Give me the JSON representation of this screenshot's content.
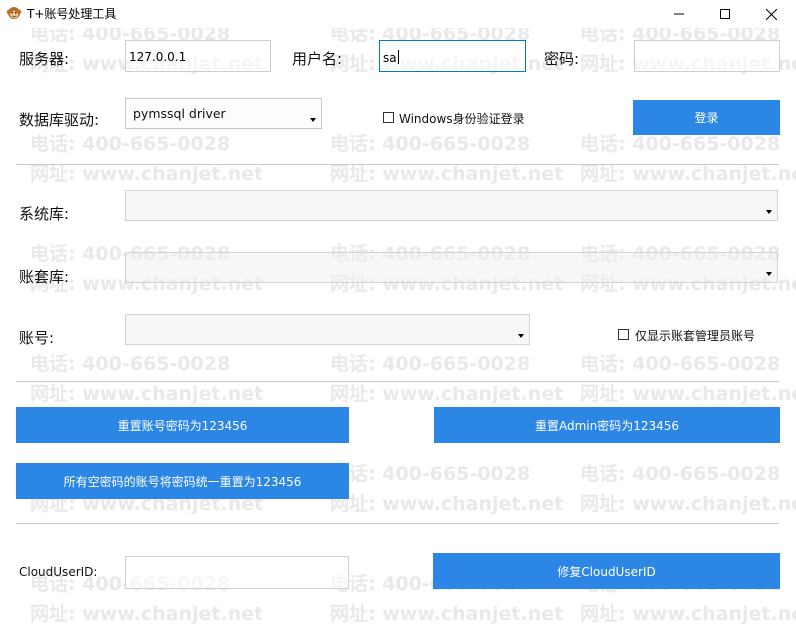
{
  "window": {
    "title": "T+账号处理工具",
    "app_icon": "monkey-icon",
    "controls": [
      "minimize-icon",
      "maximize-icon",
      "close-icon"
    ]
  },
  "watermark": {
    "phone": "电话: 400-665-0028",
    "site": "网址: www.chanjet.net",
    "color": "#e9e9e9"
  },
  "server": {
    "label": "服务器:",
    "value": "127.0.0.1"
  },
  "username": {
    "label": "用户名:",
    "value": "sa"
  },
  "password": {
    "label": "密码:",
    "value": ""
  },
  "driver": {
    "label": "数据库驱动:",
    "selected": "pymssql driver"
  },
  "windows_auth": {
    "label": "Windows身份验证登录",
    "checked": false
  },
  "login_button": "登录",
  "system_db": {
    "label": "系统库:",
    "selected": ""
  },
  "account_set_db": {
    "label": "账套库:",
    "selected": ""
  },
  "account": {
    "label": "账号:",
    "selected": ""
  },
  "admin_only": {
    "label": "仅显示账套管理员账号",
    "checked": false
  },
  "actions": {
    "reset_account_pwd": "重置账号密码为123456",
    "reset_admin_pwd": "重置Admin密码为123456",
    "reset_empty_pwd": "所有空密码的账号将密码统一重置为123456"
  },
  "cloud_user": {
    "label": "CloudUserID:",
    "value": "",
    "fix_button": "修复CloudUserID"
  },
  "colors": {
    "accent": "#2b86e6",
    "focus_border": "#0078d7"
  }
}
